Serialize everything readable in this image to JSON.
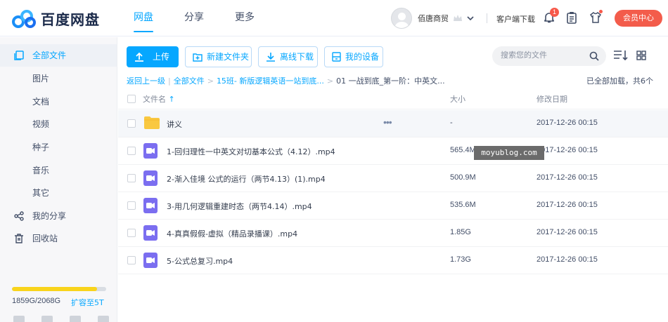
{
  "header": {
    "logo_text": "百度网盘",
    "nav": [
      "网盘",
      "分享",
      "更多"
    ],
    "username": "佰唐商贸",
    "client_download": "客户端下载",
    "notification_count": "1",
    "vip_button": "会员中心"
  },
  "sidebar": {
    "items": [
      {
        "label": "全部文件",
        "icon": "files-icon"
      },
      {
        "label": "图片",
        "icon": ""
      },
      {
        "label": "文档",
        "icon": ""
      },
      {
        "label": "视频",
        "icon": ""
      },
      {
        "label": "种子",
        "icon": ""
      },
      {
        "label": "音乐",
        "icon": ""
      },
      {
        "label": "其它",
        "icon": ""
      },
      {
        "label": "我的分享",
        "icon": "share-icon"
      },
      {
        "label": "回收站",
        "icon": "trash-icon"
      }
    ],
    "storage_text": "1859G/2068G",
    "storage_used_fraction": 0.9,
    "expand_link": "扩容至5T"
  },
  "toolbar": {
    "upload": "上传",
    "new_folder": "新建文件夹",
    "offline_download": "离线下载",
    "my_devices": "我的设备",
    "search_placeholder": "搜索您的文件"
  },
  "breadcrumb": {
    "back": "返回上一级",
    "all_files": "全部文件",
    "level1": "15班- 新版逻辑英语一站到底...",
    "current": "01 一战到底_第一阶：中英文..."
  },
  "loaded_info": "已全部加载，共6个",
  "table": {
    "columns": {
      "name": "文件名",
      "size": "大小",
      "date": "修改日期"
    },
    "rows": [
      {
        "name": "讲义",
        "size": "-",
        "date": "2017-12-26 00:15",
        "type": "folder"
      },
      {
        "name": "1-回归理性一中英文对切基本公式（4.12）.mp4",
        "size": "565.4M",
        "date": "2017-12-26 00:15",
        "type": "video"
      },
      {
        "name": "2-渐入佳境 公式的运行（两节4.13）(1).mp4",
        "size": "500.9M",
        "date": "2017-12-26 00:15",
        "type": "video"
      },
      {
        "name": "3-用几何逻辑重建时态（两节4.14）.mp4",
        "size": "535.6M",
        "date": "2017-12-26 00:15",
        "type": "video"
      },
      {
        "name": "4-真真假假-虚拟（精品录播课）.mp4",
        "size": "1.85G",
        "date": "2017-12-26 00:15",
        "type": "video"
      },
      {
        "name": "5-公式总复习.mp4",
        "size": "1.73G",
        "date": "2017-12-26 00:15",
        "type": "video"
      }
    ]
  },
  "watermark": "moyublog.com",
  "colors": {
    "accent": "#06a7ff",
    "vip": "#f35c4b",
    "storage": "#f9d41c",
    "video_icon": "#7b6ef0",
    "folder": "#f9c840"
  }
}
